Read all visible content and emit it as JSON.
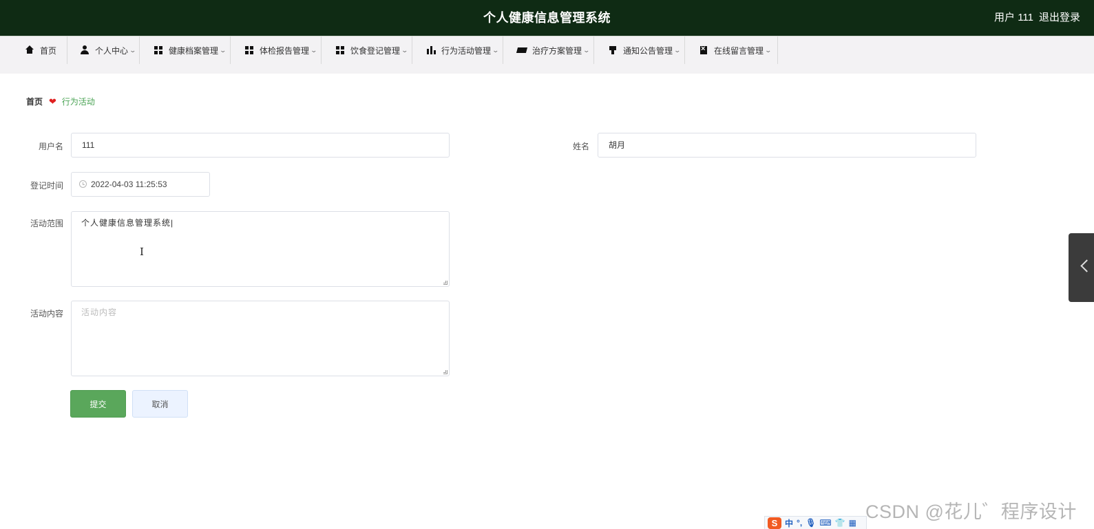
{
  "header": {
    "title": "个人健康信息管理系统",
    "user_label": "用户 111",
    "logout_label": "退出登录"
  },
  "nav": {
    "items": [
      {
        "label": "首页",
        "icon": "home-icon",
        "has_dropdown": false
      },
      {
        "label": "个人中心",
        "icon": "user-icon",
        "has_dropdown": true
      },
      {
        "label": "健康档案管理",
        "icon": "grid-icon",
        "has_dropdown": true
      },
      {
        "label": "体检报告管理",
        "icon": "grid-icon",
        "has_dropdown": true
      },
      {
        "label": "饮食登记管理",
        "icon": "grid-icon",
        "has_dropdown": true
      },
      {
        "label": "行为活动管理",
        "icon": "bar-chart-icon",
        "has_dropdown": true
      },
      {
        "label": "治疗方案管理",
        "icon": "ticket-icon",
        "has_dropdown": true
      },
      {
        "label": "通知公告管理",
        "icon": "brush-icon",
        "has_dropdown": true
      },
      {
        "label": "在线留言管理",
        "icon": "clipboard-icon",
        "has_dropdown": true
      }
    ]
  },
  "breadcrumb": {
    "home": "首页",
    "current": "行为活动"
  },
  "form": {
    "username": {
      "label": "用户名",
      "value": "111"
    },
    "name": {
      "label": "姓名",
      "value": "胡月"
    },
    "register_time": {
      "label": "登记时间",
      "value": "2022-04-03 11:25:53"
    },
    "activity_scope": {
      "label": "活动范围",
      "value": "个人健康信息管理系统|"
    },
    "activity_content": {
      "label": "活动内容",
      "value": "",
      "placeholder": "活动内容"
    }
  },
  "buttons": {
    "submit": "提交",
    "cancel": "取消"
  },
  "ime_toolbar": {
    "logo": "S",
    "mode": "中"
  },
  "watermark": "CSDN @花儿゛程序设计",
  "colors": {
    "header_bg": "#0f2b14",
    "accent_green": "#5aa75b",
    "breadcrumb_current": "#4aa354",
    "heart": "#e02020"
  }
}
